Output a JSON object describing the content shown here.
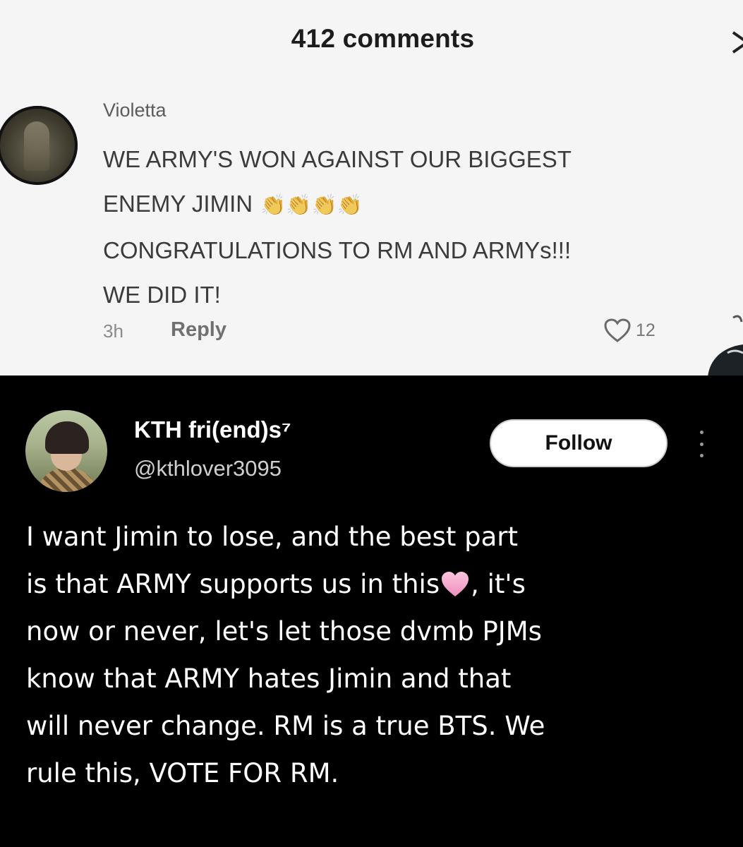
{
  "comments_panel": {
    "title": "412 comments",
    "comment": {
      "username": "Violetta",
      "lines": [
        "WE ARMY'S WON AGAINST OUR BIGGEST",
        "ENEMY JIMIN",
        "CONGRATULATIONS TO RM AND ARMYs!!!",
        "WE DID IT!"
      ],
      "emoji": "👏👏👏👏",
      "time": "3h",
      "reply_label": "Reply",
      "like_count": "12"
    }
  },
  "tweet": {
    "display_name": "KTH fri(end)s⁷",
    "handle": "@kthlover3095",
    "follow_label": "Follow",
    "body_lines": [
      "I want Jimin to lose, and the best part",
      "is that ARMY supports us in this",
      ", it's",
      "now or never, let's let those dvmb PJMs",
      "know that ARMY hates Jimin and that",
      "will never change. RM is a true BTS. We",
      "rule this, VOTE FOR RM."
    ],
    "emoji_name": "pink-heart-icon",
    "colors": {
      "heart": "#f5a9cc",
      "background": "#000000",
      "follow_bg": "#ffffff"
    }
  }
}
